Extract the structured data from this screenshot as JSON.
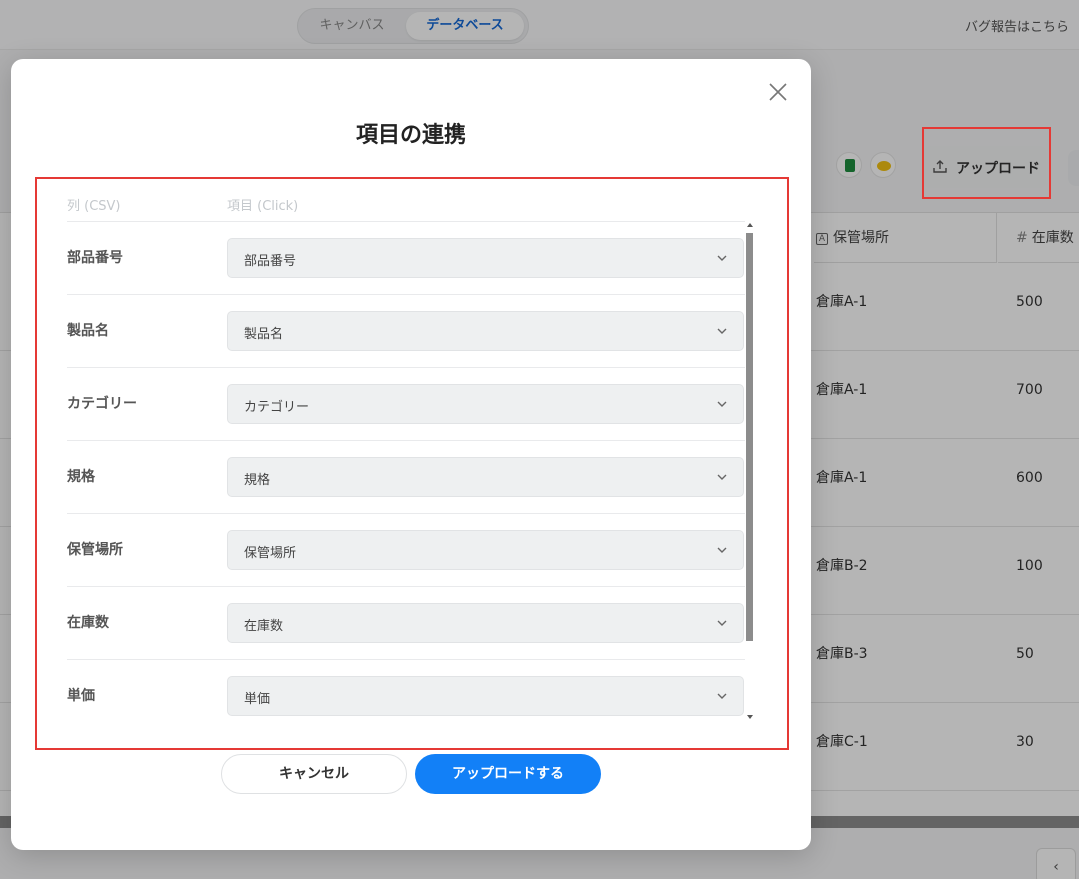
{
  "header": {
    "tabs": [
      {
        "label": "キャンバス",
        "active": false
      },
      {
        "label": "データベース",
        "active": true
      }
    ],
    "bug_report_link": "バグ報告はこちら"
  },
  "toolbar": {
    "integration_icons": [
      "google-sheets-icon",
      "integration-app-icon"
    ],
    "upload_label": "アップロード"
  },
  "table": {
    "columns": [
      {
        "label": "保管場所",
        "type_icon": "text-type-icon"
      },
      {
        "label": "在庫数",
        "type_icon": "number-type-icon"
      }
    ],
    "rows": [
      {
        "location": "倉庫A-1",
        "stock": "500"
      },
      {
        "location": "倉庫A-1",
        "stock": "700"
      },
      {
        "location": "倉庫A-1",
        "stock": "600"
      },
      {
        "location": "倉庫B-2",
        "stock": "100"
      },
      {
        "location": "倉庫B-3",
        "stock": "50"
      },
      {
        "location": "倉庫C-1",
        "stock": "30"
      }
    ],
    "pagination_prev": "‹"
  },
  "modal": {
    "title": "項目の連携",
    "column_headers": {
      "csv": "列 (CSV)",
      "click": "項目 (Click)"
    },
    "mappings": [
      {
        "csv_column": "部品番号",
        "field": "部品番号"
      },
      {
        "csv_column": "製品名",
        "field": "製品名"
      },
      {
        "csv_column": "カテゴリー",
        "field": "カテゴリー"
      },
      {
        "csv_column": "規格",
        "field": "規格"
      },
      {
        "csv_column": "保管場所",
        "field": "保管場所"
      },
      {
        "csv_column": "在庫数",
        "field": "在庫数"
      },
      {
        "csv_column": "単価",
        "field": "単価"
      }
    ],
    "cancel_label": "キャンセル",
    "submit_label": "アップロードする"
  },
  "colors": {
    "accent": "#1280f7",
    "highlight_border": "#e53935",
    "active_tab_text": "#1469d6"
  }
}
